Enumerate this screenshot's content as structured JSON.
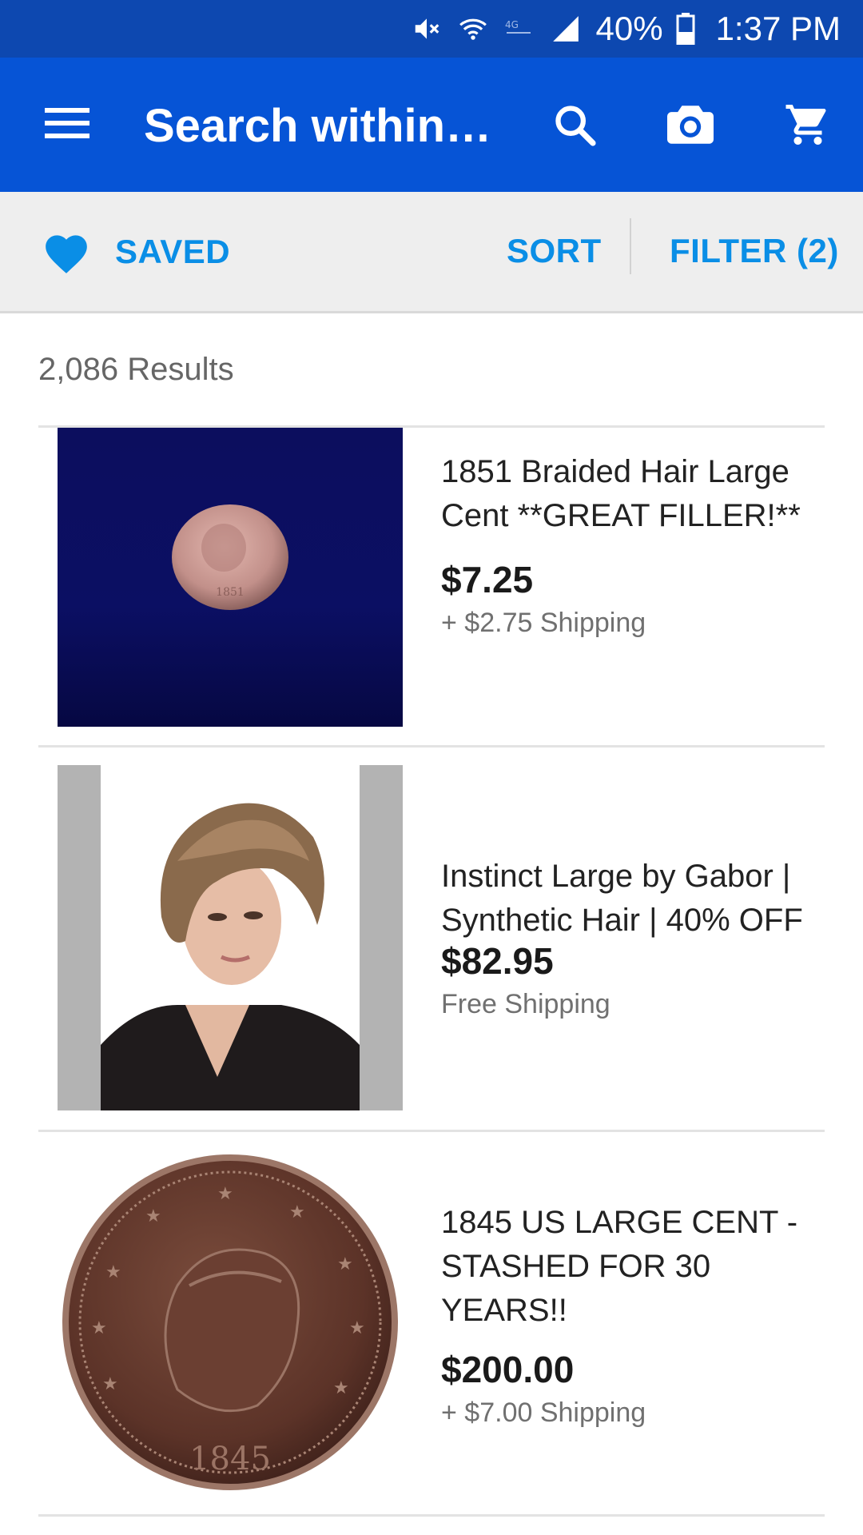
{
  "status_bar": {
    "battery": "40%",
    "time": "1:37 PM",
    "icons": [
      "mute-icon",
      "wifi-icon",
      "lte-icon",
      "signal-icon",
      "battery-icon"
    ],
    "background": "#0d48b0"
  },
  "app_bar": {
    "search_text": "Search within…",
    "icons": [
      "menu-icon",
      "search-icon",
      "camera-icon",
      "cart-icon"
    ],
    "background": "#0654d6"
  },
  "toolbar": {
    "saved_label": "SAVED",
    "sort_label": "SORT",
    "filter_label": "FILTER (2)",
    "accent": "#0a8ee6"
  },
  "results": {
    "count_label": "2,086 Results",
    "items": [
      {
        "title": "1851 Braided Hair Large Cent **GREAT FILLER!**",
        "price": "$7.25",
        "shipping": "+ $2.75 Shipping",
        "coin_year": "1851"
      },
      {
        "title": "Instinct Large by Gabor | Synthetic Hair |  40% OFF",
        "price": "$82.95",
        "shipping": "Free Shipping"
      },
      {
        "title": "1845 US LARGE CENT - STASHED FOR 30 YEARS!!",
        "price": "$200.00",
        "shipping": "+ $7.00 Shipping",
        "coin_year": "1845"
      }
    ]
  }
}
